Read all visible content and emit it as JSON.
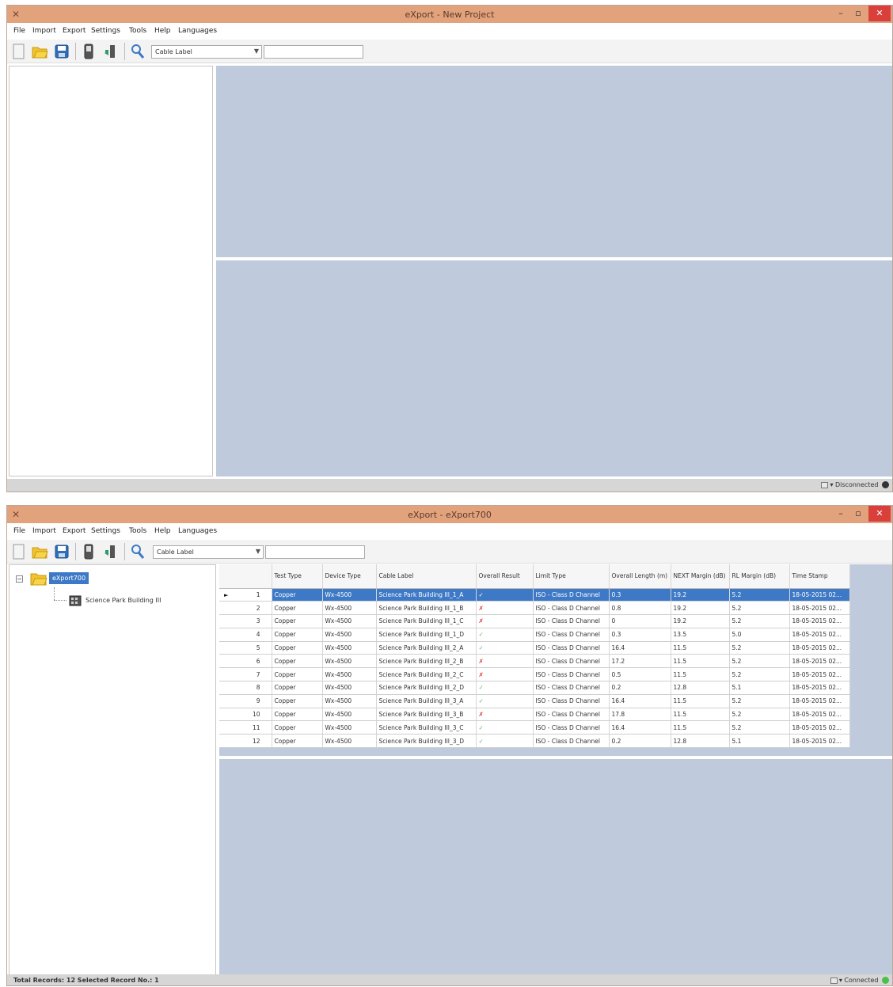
{
  "window1": {
    "title": "eXport - New Project",
    "menu": [
      "File",
      "Import",
      "Export",
      "Settings",
      "Tools",
      "Help",
      "Languages"
    ],
    "filter_combo": "Cable Label",
    "search_value": "",
    "status": "Disconnected",
    "status_color": "#333333"
  },
  "window2": {
    "title": "eXport - eXport700",
    "menu": [
      "File",
      "Import",
      "Export",
      "Settings",
      "Tools",
      "Help",
      "Languages"
    ],
    "filter_combo": "Cable Label",
    "search_value": "",
    "tree": {
      "root": "eXport700",
      "child": "Science Park Building III"
    },
    "table": {
      "columns": [
        "",
        "Test Type",
        "Device Type",
        "Cable Label",
        "Overall Result",
        "Limit Type",
        "Overall Length (m)",
        "NEXT Margin (dB)",
        "RL Margin (dB)",
        "Time Stamp"
      ],
      "rows": [
        {
          "n": "1",
          "test": "Copper",
          "device": "Wx-4500",
          "label": "Science Park Building III_1_A",
          "result": "✓",
          "result_type": "pass",
          "limit": "ISO - Class D Channel",
          "length": "0.3",
          "next": "19.2",
          "rl": "5.2",
          "time": "18-05-2015 02..."
        },
        {
          "n": "2",
          "test": "Copper",
          "device": "Wx-4500",
          "label": "Science Park Building III_1_B",
          "result": "✗",
          "result_type": "fail",
          "limit": "ISO - Class D Channel",
          "length": "0.8",
          "next": "19.2",
          "rl": "5.2",
          "time": "18-05-2015 02..."
        },
        {
          "n": "3",
          "test": "Copper",
          "device": "Wx-4500",
          "label": "Science Park Building III_1_C",
          "result": "✗",
          "result_type": "fail",
          "limit": "ISO - Class D Channel",
          "length": "0",
          "next": "19.2",
          "rl": "5.2",
          "time": "18-05-2015 02..."
        },
        {
          "n": "4",
          "test": "Copper",
          "device": "Wx-4500",
          "label": "Science Park Building III_1_D",
          "result": "✓",
          "result_type": "pass",
          "limit": "ISO - Class D Channel",
          "length": "0.3",
          "next": "13.5",
          "rl": "5.0",
          "time": "18-05-2015 02..."
        },
        {
          "n": "5",
          "test": "Copper",
          "device": "Wx-4500",
          "label": "Science Park Building III_2_A",
          "result": "✓",
          "result_type": "pass",
          "limit": "ISO - Class D Channel",
          "length": "16.4",
          "next": "11.5",
          "rl": "5.2",
          "time": "18-05-2015 02..."
        },
        {
          "n": "6",
          "test": "Copper",
          "device": "Wx-4500",
          "label": "Science Park Building III_2_B",
          "result": "✗",
          "result_type": "fail",
          "limit": "ISO - Class D Channel",
          "length": "17.2",
          "next": "11.5",
          "rl": "5.2",
          "time": "18-05-2015 02..."
        },
        {
          "n": "7",
          "test": "Copper",
          "device": "Wx-4500",
          "label": "Science Park Building III_2_C",
          "result": "✗",
          "result_type": "fail",
          "limit": "ISO - Class D Channel",
          "length": "0.5",
          "next": "11.5",
          "rl": "5.2",
          "time": "18-05-2015 02..."
        },
        {
          "n": "8",
          "test": "Copper",
          "device": "Wx-4500",
          "label": "Science Park Building III_2_D",
          "result": "✓",
          "result_type": "pass",
          "limit": "ISO - Class D Channel",
          "length": "0.2",
          "next": "12.8",
          "rl": "5.1",
          "time": "18-05-2015 02..."
        },
        {
          "n": "9",
          "test": "Copper",
          "device": "Wx-4500",
          "label": "Science Park Building III_3_A",
          "result": "✓",
          "result_type": "pass",
          "limit": "ISO - Class D Channel",
          "length": "16.4",
          "next": "11.5",
          "rl": "5.2",
          "time": "18-05-2015 02..."
        },
        {
          "n": "10",
          "test": "Copper",
          "device": "Wx-4500",
          "label": "Science Park Building III_3_B",
          "result": "✗",
          "result_type": "fail",
          "limit": "ISO - Class D Channel",
          "length": "17.8",
          "next": "11.5",
          "rl": "5.2",
          "time": "18-05-2015 02..."
        },
        {
          "n": "11",
          "test": "Copper",
          "device": "Wx-4500",
          "label": "Science Park Building III_3_C",
          "result": "✓",
          "result_type": "pass",
          "limit": "ISO - Class D Channel",
          "length": "16.4",
          "next": "11.5",
          "rl": "5.2",
          "time": "18-05-2015 02..."
        },
        {
          "n": "12",
          "test": "Copper",
          "device": "Wx-4500",
          "label": "Science Park Building III_3_D",
          "result": "✓",
          "result_type": "pass",
          "limit": "ISO - Class D Channel",
          "length": "0.2",
          "next": "12.8",
          "rl": "5.1",
          "time": "18-05-2015 02..."
        }
      ],
      "selected_row": 0
    },
    "status_left": "Total Records: 12   Selected Record No.: 1",
    "status": "Connected",
    "status_color": "#4cbf4c"
  },
  "colors": {
    "titlebar": "#e2a27c",
    "pane": "#bfcbdc",
    "selection": "#3d79c6",
    "close": "#d9403c"
  },
  "icons": [
    "app-icon",
    "new-file-icon",
    "open-folder-icon",
    "save-icon",
    "device-icon",
    "connect-icon",
    "search-icon",
    "folder-icon",
    "building-icon",
    "minimize-icon",
    "restore-icon",
    "close-icon"
  ]
}
